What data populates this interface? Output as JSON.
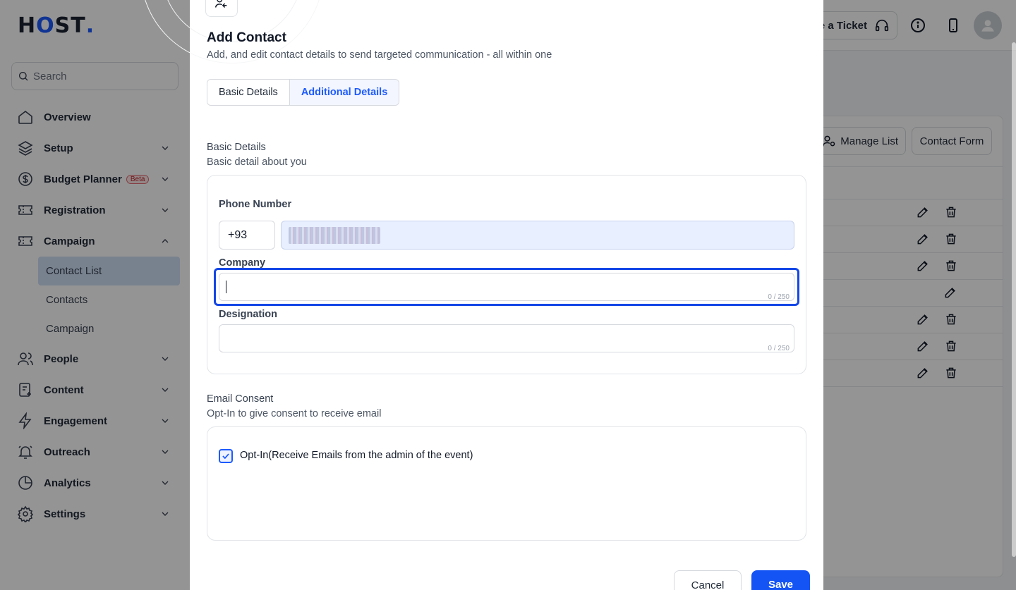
{
  "brand": {
    "logo_h": "H",
    "logo_o": "O",
    "logo_rest": "ST",
    "logo_dot": "."
  },
  "sidebar": {
    "search_placeholder": "Search",
    "items": [
      {
        "label": "Overview",
        "icon": "home-icon"
      },
      {
        "label": "Setup",
        "icon": "layers-icon"
      },
      {
        "label": "Budget Planner",
        "badge": "Beta",
        "icon": "dollar-icon"
      },
      {
        "label": "Registration",
        "icon": "ticket-icon"
      },
      {
        "label": "Campaign",
        "icon": "ticket-icon"
      }
    ],
    "campaign_sub": [
      {
        "label": "Contact List",
        "active": true
      },
      {
        "label": "Contacts"
      },
      {
        "label": "Campaign"
      }
    ],
    "items_after": [
      {
        "label": "People",
        "icon": "people-icon"
      },
      {
        "label": "Content",
        "icon": "content-icon"
      },
      {
        "label": "Engagement",
        "icon": "bolt-icon"
      },
      {
        "label": "Outreach",
        "icon": "bell-icon"
      },
      {
        "label": "Analytics",
        "icon": "pie-icon"
      },
      {
        "label": "Settings",
        "icon": "gear-icon"
      }
    ]
  },
  "topbar": {
    "ticket_label": "e a Ticket"
  },
  "background_panel": {
    "manage_list": "Manage List",
    "contact_form": "Contact Form"
  },
  "modal": {
    "title": "Add Contact",
    "subtitle": "Add, and edit contact details to send targeted communication - all within one",
    "tabs": [
      {
        "label": "Basic Details",
        "active": false
      },
      {
        "label": "Additional Details",
        "active": true
      }
    ],
    "basic_section": {
      "title": "Basic Details",
      "subtitle": "Basic detail about you"
    },
    "phone": {
      "label": "Phone Number",
      "code": "+93"
    },
    "company": {
      "label": "Company",
      "value": "",
      "counter": "0 / 250"
    },
    "designation": {
      "label": "Designation",
      "value": "",
      "counter": "0 / 250"
    },
    "email_section": {
      "title": "Email Consent",
      "subtitle": "Opt-In to give consent to receive email"
    },
    "opt_in": {
      "label": "Opt-In(Receive Emails from the admin of the event)",
      "checked": true
    },
    "buttons": {
      "cancel": "Cancel",
      "save": "Save"
    }
  },
  "colors": {
    "accent": "#1d5bff",
    "save": "#1454f5",
    "focus": "#1447e6"
  }
}
